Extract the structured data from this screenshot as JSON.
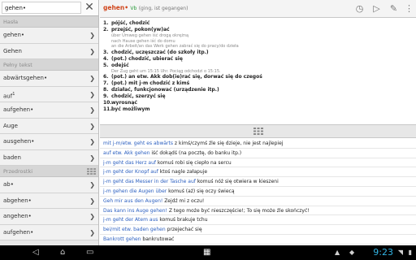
{
  "search": {
    "value": "gehen•"
  },
  "sections": {
    "hasla": "Hasła",
    "pelny_tekst": "Pełny tekst",
    "przedrostki": "Przedrostki"
  },
  "hasla_items": [
    {
      "label": "gehen•"
    },
    {
      "label": "Gehen"
    }
  ],
  "pelny_items": [
    {
      "label": "abwärtsgehen•"
    },
    {
      "label": "auf",
      "sup": "1"
    },
    {
      "label": "aufgehen•"
    },
    {
      "label": "Auge"
    },
    {
      "label": "ausgehen•"
    },
    {
      "label": "baden"
    }
  ],
  "przedrostki_items": [
    {
      "label": "ab•"
    },
    {
      "label": "abgehen•"
    },
    {
      "label": "angehen•"
    },
    {
      "label": "aufgehen•"
    }
  ],
  "entry": {
    "headword": "gehen•",
    "pos": "Vb",
    "grammar": "(ging, ist gegangen)",
    "senses": [
      {
        "num": "1.",
        "text": "pójść, chodzić"
      },
      {
        "num": "2.",
        "text": "przejść, pokon(yw)ać"
      },
      {
        "sub": "über Umweg gehen iść drogą okrężną"
      },
      {
        "sub": "nach Hause gehen iść do domu"
      },
      {
        "sub": "an die Arbeit/an das Werk gehen zabrać się do pracy/do dzieła"
      },
      {
        "num": "3.",
        "text": "chodzić, uczęszczać (do szkoły itp.)"
      },
      {
        "num": "4.",
        "text": "(pot.) chodzić, ubierać się"
      },
      {
        "num": "5.",
        "text": "odejść"
      },
      {
        "sub": "Der Zug geht um 15:15 Uhr. Pociąg odchodzi o 15:15."
      },
      {
        "num": "6.",
        "text": "(pot.) an etw. Akk dob(ie)rać się, dorwać się do czegoś"
      },
      {
        "num": "7.",
        "text": "(pot.) mit j-m chodzić z kimś"
      },
      {
        "num": "8.",
        "text": "działać, funkcjonować (urządzenie itp.)"
      },
      {
        "num": "9.",
        "text": "chodzić, szerzyć się"
      },
      {
        "num": "10.",
        "text": "wyrosnąć"
      },
      {
        "num": "11.",
        "text": "być możliwym"
      }
    ]
  },
  "examples": [
    {
      "de": "mit j-m/etw. geht es abwärts",
      "pl": " z kimś/czymś źle się dzieje, nie jest najlepiej"
    },
    {
      "de": "auf etw. Akk gehen",
      "pl": " iść dokądś (na pocztę, do banku itp.)"
    },
    {
      "de": "j-m geht das Herz auf",
      "pl": " komuś robi się ciepło na sercu"
    },
    {
      "de": "j-m geht der Knopf auf",
      "pl": " ktoś nagle załapuje"
    },
    {
      "de": "j-m geht das Messer in der Tasche auf",
      "pl": " komuś nóż się otwiera w kieszeni"
    },
    {
      "de": "j-m gehen die Augen über",
      "pl": " komuś (aż) się oczy świecą"
    },
    {
      "de": "Geh mir aus den Augen!",
      "pl": " Zejdź mi z oczu!"
    },
    {
      "de": "Das kann ins Auge gehen!",
      "pl": " Z tego może być nieszczęście!; To się może źle skończyć!"
    },
    {
      "de": "j-m geht der Atem aus",
      "pl": " komuś brakuje tchu"
    },
    {
      "de": "bei/mit etw. baden gehen",
      "pl": " przejechać się"
    },
    {
      "de": "Bankrott gehen",
      "pl": " bankrutować"
    }
  ],
  "statusbar": {
    "time": "9:23"
  }
}
